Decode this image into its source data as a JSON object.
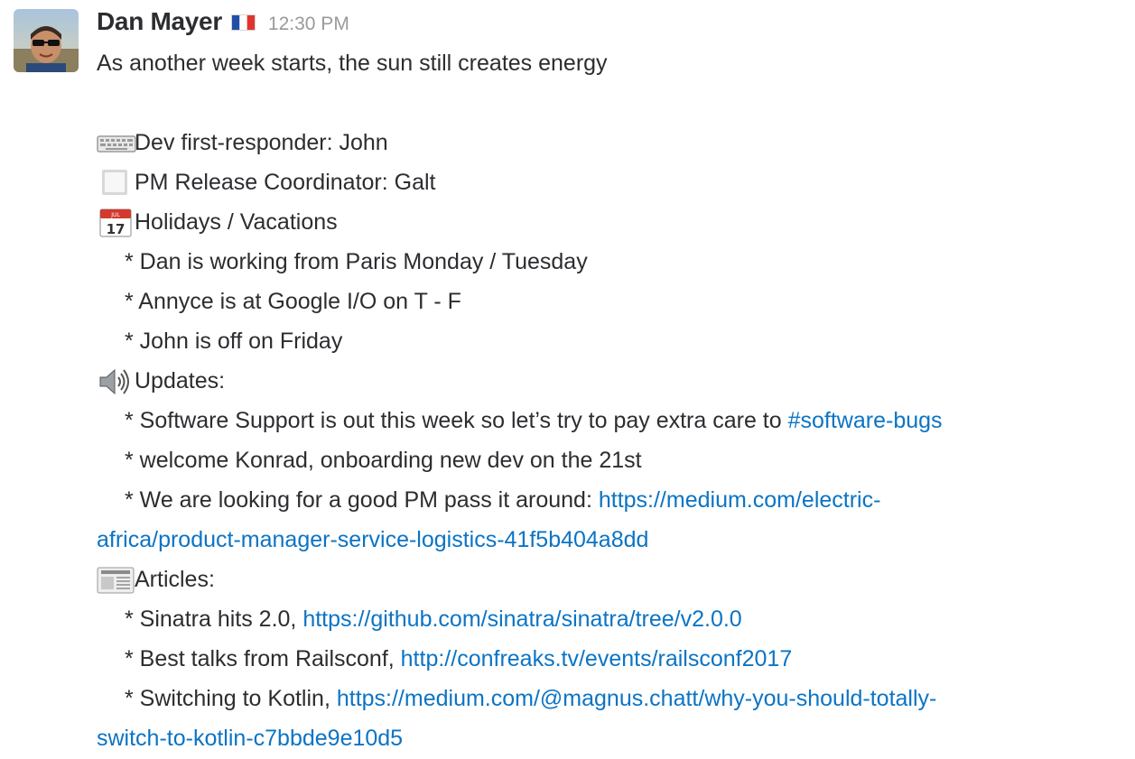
{
  "message": {
    "sender": "Dan Mayer",
    "flag_icon": "flag-france-icon",
    "timestamp": "12:30 PM",
    "intro": "As another week starts, the sun still creates energy",
    "dev_responder": {
      "icon": "keyboard-icon",
      "text": "Dev first-responder: John"
    },
    "pm_coordinator": {
      "icon": "white-square-icon",
      "text": "PM Release Coordinator: Galt"
    },
    "holidays": {
      "icon": "calendar-icon",
      "text": "Holidays / Vacations",
      "items": [
        "* Dan is working from Paris Monday / Tuesday",
        "* Annyce is at Google I/O on T - F",
        "* John is off on Friday"
      ]
    },
    "updates": {
      "icon": "speaker-icon",
      "text": "Updates:",
      "support_prefix": "* Software Support is out this week so let’s try to pay extra care to ",
      "support_channel": "#software-bugs",
      "welcome": "* welcome Konrad, onboarding new dev on the 21st",
      "pm_prefix": "* We are looking for a good PM pass it around: ",
      "pm_link_part1": "https://medium.com/electric-",
      "pm_link_part2": "africa/product-manager-service-logistics-41f5b404a8dd"
    },
    "articles": {
      "icon": "newspaper-icon",
      "text": "Articles:",
      "sinatra_prefix": "* Sinatra hits 2.0, ",
      "sinatra_link": "https://github.com/sinatra/sinatra/tree/v2.0.0",
      "railsconf_prefix": "* Best talks from Railsconf, ",
      "railsconf_link": "http://confreaks.tv/events/railsconf2017",
      "kotlin_prefix": "* Switching to Kotlin, ",
      "kotlin_link_part1": "https://medium.com/@magnus.chatt/why-you-should-totally-",
      "kotlin_link_part2": "switch-to-kotlin-c7bbde9e10d5"
    },
    "colors": {
      "link": "#0b74c4",
      "text": "#2c2d30",
      "timestamp": "#9a9a9a"
    }
  }
}
